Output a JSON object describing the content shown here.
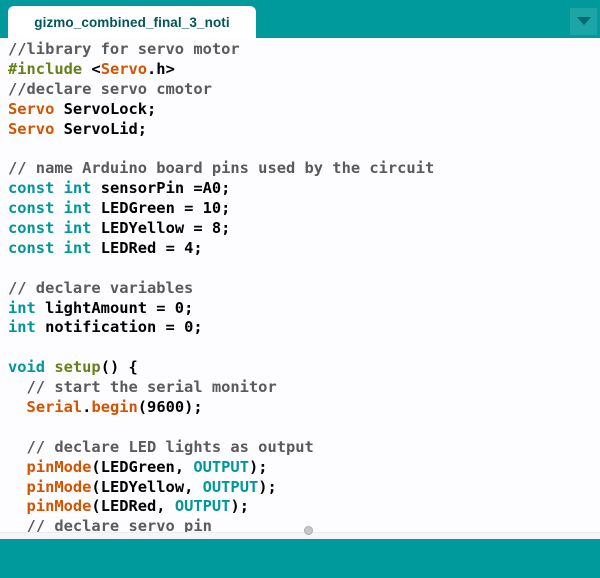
{
  "window": {
    "tab_title": "gizmo_combined_final_3_noti"
  },
  "colors": {
    "accent_teal": "#00999c",
    "tab_bg": "#ffffff",
    "tab_text": "#00565c",
    "dropdown_bg": "#1ba5a7",
    "dropdown_arrow": "#006b6e",
    "code_bg": "#fdfcfe",
    "plain": "#000000",
    "comment": "#5a5a5a",
    "keyword": "#00979c",
    "function": "#d35400",
    "structure": "#66801a",
    "scroll_track": "#f6f5f7",
    "scroll_thumb": "#c7c7c7"
  },
  "icons": {
    "tab_menu": "chevron-down-icon",
    "scroll_handle": "scrollbar-dot"
  },
  "code": {
    "lines": [
      {
        "segments": [
          {
            "t": "//library for servo motor",
            "s": "comment"
          }
        ]
      },
      {
        "segments": [
          {
            "t": "#include",
            "s": "structure"
          },
          {
            "t": " <",
            "s": "plain"
          },
          {
            "t": "Servo",
            "s": "function"
          },
          {
            "t": ".h>",
            "s": "plain"
          }
        ]
      },
      {
        "segments": [
          {
            "t": "//declare servo cmotor",
            "s": "comment"
          }
        ]
      },
      {
        "segments": [
          {
            "t": "Servo",
            "s": "function"
          },
          {
            "t": " ServoLock;",
            "s": "plain"
          }
        ]
      },
      {
        "segments": [
          {
            "t": "Servo",
            "s": "function"
          },
          {
            "t": " ServoLid;",
            "s": "plain"
          }
        ]
      },
      {
        "segments": []
      },
      {
        "segments": [
          {
            "t": "// name Arduino board pins used by the circuit",
            "s": "comment"
          }
        ]
      },
      {
        "segments": [
          {
            "t": "const",
            "s": "keyword"
          },
          {
            "t": " ",
            "s": "plain"
          },
          {
            "t": "int",
            "s": "keyword"
          },
          {
            "t": " sensorPin =A0;",
            "s": "plain"
          }
        ]
      },
      {
        "segments": [
          {
            "t": "const",
            "s": "keyword"
          },
          {
            "t": " ",
            "s": "plain"
          },
          {
            "t": "int",
            "s": "keyword"
          },
          {
            "t": " LEDGreen = 10;",
            "s": "plain"
          }
        ]
      },
      {
        "segments": [
          {
            "t": "const",
            "s": "keyword"
          },
          {
            "t": " ",
            "s": "plain"
          },
          {
            "t": "int",
            "s": "keyword"
          },
          {
            "t": " LEDYellow = 8;",
            "s": "plain"
          }
        ]
      },
      {
        "segments": [
          {
            "t": "const",
            "s": "keyword"
          },
          {
            "t": " ",
            "s": "plain"
          },
          {
            "t": "int",
            "s": "keyword"
          },
          {
            "t": " LEDRed = 4;",
            "s": "plain"
          }
        ]
      },
      {
        "segments": []
      },
      {
        "segments": [
          {
            "t": "// declare variables",
            "s": "comment"
          }
        ]
      },
      {
        "segments": [
          {
            "t": "int",
            "s": "keyword"
          },
          {
            "t": " lightAmount = 0;",
            "s": "plain"
          }
        ]
      },
      {
        "segments": [
          {
            "t": "int",
            "s": "keyword"
          },
          {
            "t": " notification = 0;",
            "s": "plain"
          }
        ]
      },
      {
        "segments": []
      },
      {
        "segments": [
          {
            "t": "void",
            "s": "keyword"
          },
          {
            "t": " ",
            "s": "plain"
          },
          {
            "t": "setup",
            "s": "structure"
          },
          {
            "t": "() {",
            "s": "plain"
          }
        ]
      },
      {
        "segments": [
          {
            "t": "  // start the serial monitor",
            "s": "comment"
          }
        ]
      },
      {
        "segments": [
          {
            "t": "  ",
            "s": "plain"
          },
          {
            "t": "Serial",
            "s": "function"
          },
          {
            "t": ".",
            "s": "plain"
          },
          {
            "t": "begin",
            "s": "function"
          },
          {
            "t": "(9600);",
            "s": "plain"
          }
        ]
      },
      {
        "segments": []
      },
      {
        "segments": [
          {
            "t": "  // declare LED lights as output",
            "s": "comment"
          }
        ]
      },
      {
        "segments": [
          {
            "t": "  ",
            "s": "plain"
          },
          {
            "t": "pinMode",
            "s": "function"
          },
          {
            "t": "(LEDGreen, ",
            "s": "plain"
          },
          {
            "t": "OUTPUT",
            "s": "keyword"
          },
          {
            "t": ");",
            "s": "plain"
          }
        ]
      },
      {
        "segments": [
          {
            "t": "  ",
            "s": "plain"
          },
          {
            "t": "pinMode",
            "s": "function"
          },
          {
            "t": "(LEDYellow, ",
            "s": "plain"
          },
          {
            "t": "OUTPUT",
            "s": "keyword"
          },
          {
            "t": ");",
            "s": "plain"
          }
        ]
      },
      {
        "segments": [
          {
            "t": "  ",
            "s": "plain"
          },
          {
            "t": "pinMode",
            "s": "function"
          },
          {
            "t": "(LEDRed, ",
            "s": "plain"
          },
          {
            "t": "OUTPUT",
            "s": "keyword"
          },
          {
            "t": ");",
            "s": "plain"
          }
        ]
      },
      {
        "segments": [
          {
            "t": "  // declare servo pin",
            "s": "comment"
          }
        ]
      }
    ]
  }
}
